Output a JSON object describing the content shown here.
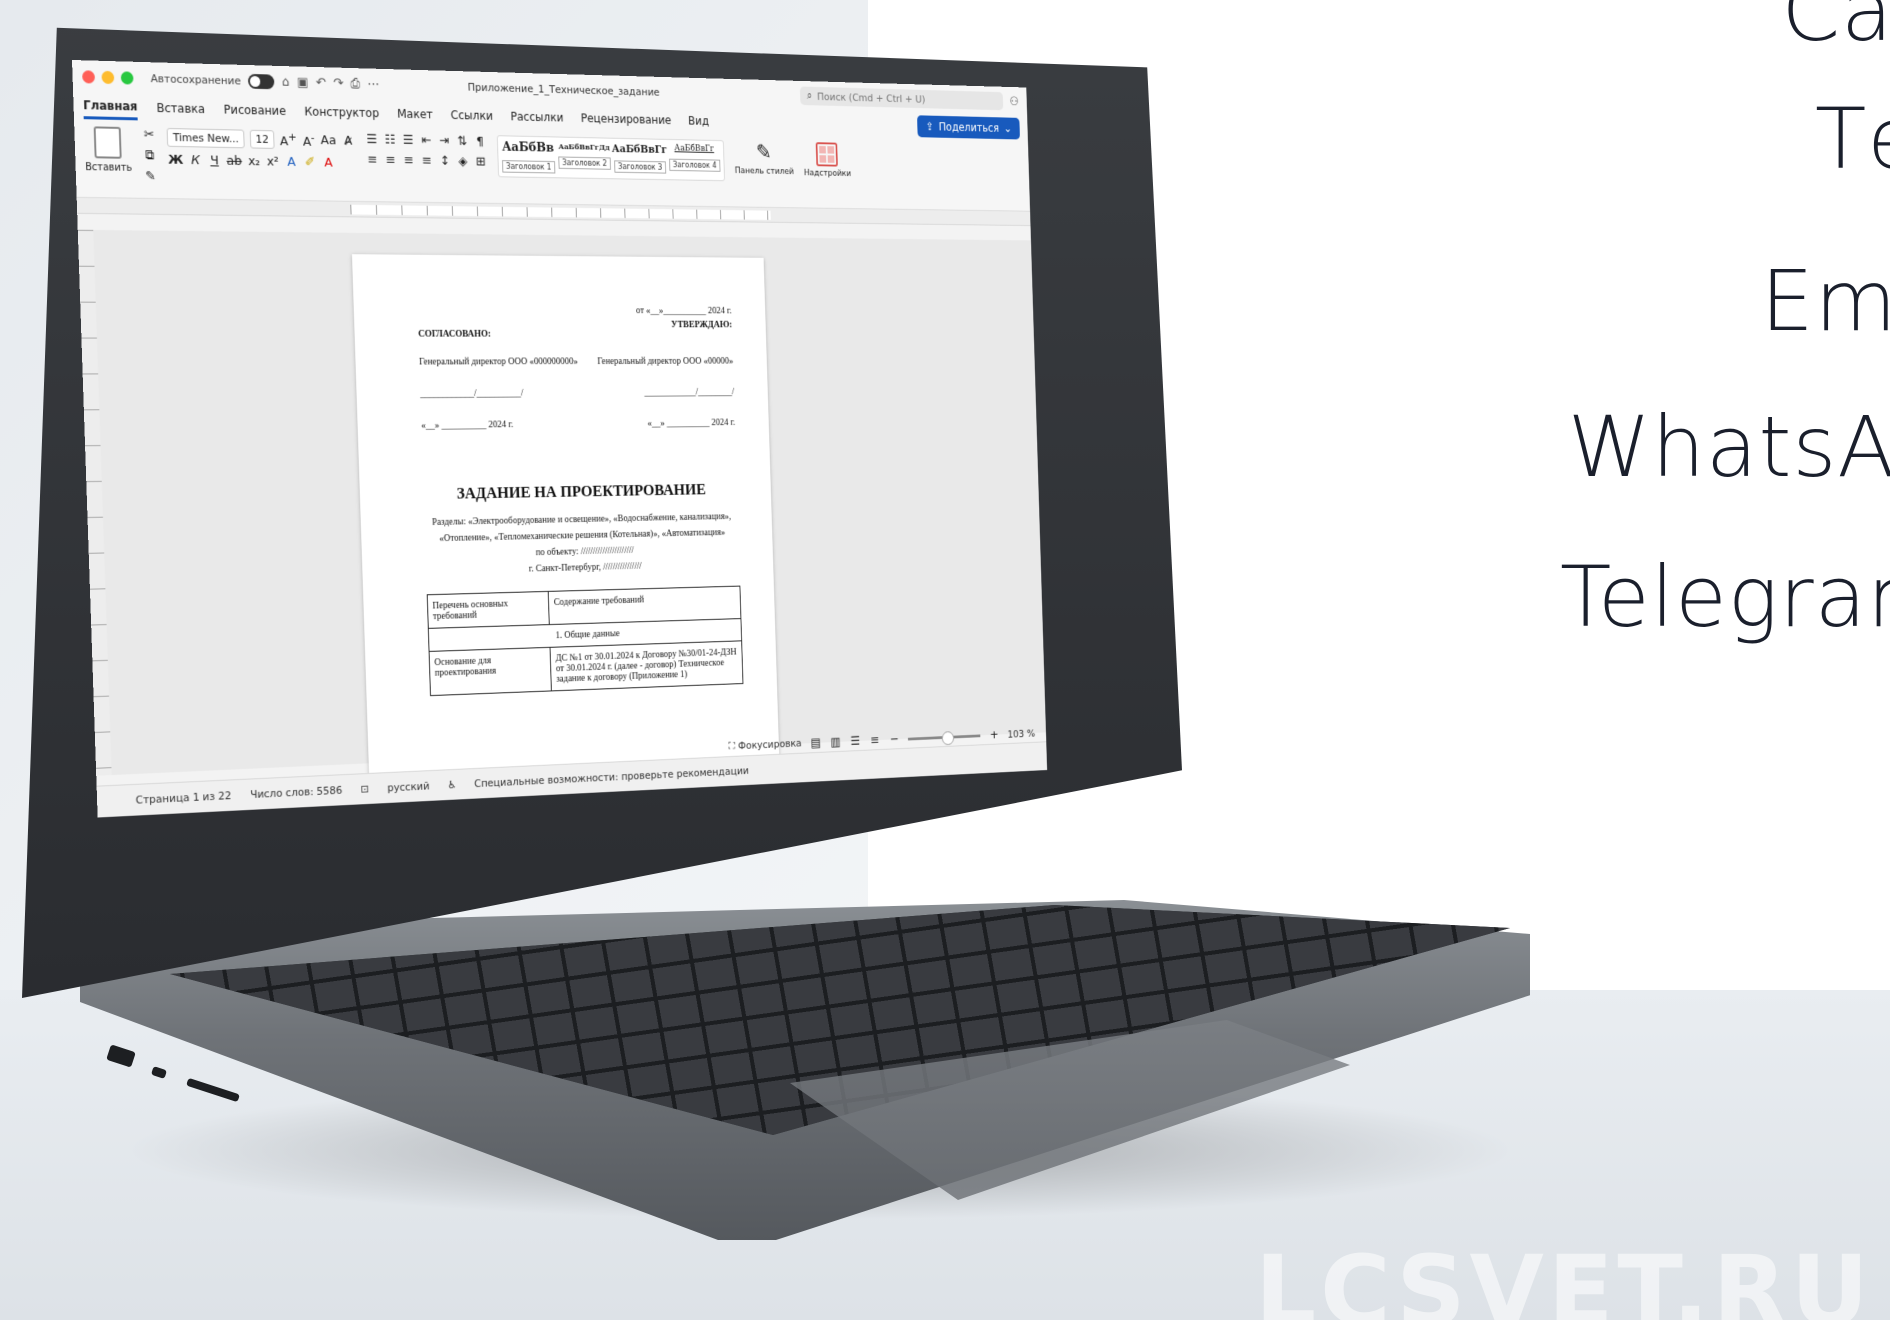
{
  "word": {
    "title_bar": {
      "autosave_label": "Автосохранение",
      "document_title": "Приложение_1_Техническое_задание",
      "search_placeholder": "Поиск (Cmd + Ctrl + U)"
    },
    "tabs": [
      "Главная",
      "Вставка",
      "Рисование",
      "Конструктор",
      "Макет",
      "Ссылки",
      "Рассылки",
      "Рецензирование",
      "Вид"
    ],
    "share_label": "Поделиться",
    "ribbon": {
      "paste_label": "Вставить",
      "font_name": "Times New...",
      "font_size": "12",
      "styles": [
        {
          "sample": "АаБбВв",
          "label": "Заголовок 1"
        },
        {
          "sample": "АаБбВвГгДд",
          "label": "Заголовок 2"
        },
        {
          "sample": "АаБбВвГг",
          "label": "Заголовок 3"
        },
        {
          "sample": "АаБбВвГг",
          "label": "Заголовок 4"
        }
      ],
      "styles_pane_label": "Панель стилей",
      "addins_label": "Надстройки"
    },
    "document": {
      "date_line": "от «__»__________ 2024 г.",
      "approved_left": "СОГЛАСОВАНО:",
      "approved_right": "УТВЕРЖДАЮ:",
      "director_left": "Генеральный директор ООО «000000000»",
      "director_right": "Генеральный директор ООО «00000»",
      "signature_line_left": "____________/__________/",
      "signature_line_right": "____________/________/",
      "date_left": "«__» __________ 2024 г.",
      "date_right": "«__» __________ 2024 г.",
      "heading": "ЗАДАНИЕ НА ПРОЕКТИРОВАНИЕ",
      "sections_line1": "Разделы: «Электрооборудование и освещение», «Водоснабжение, канализация»,",
      "sections_line2": "«Отопление», «Тепломеханические решения (Котельная)», «Автоматизация»",
      "object_line": "по объекту: //////////////////////",
      "city_line": "г. Санкт-Петербург, ////////////////",
      "table": {
        "header_left": "Перечень основных требований",
        "header_right": "Содержание требований",
        "section_row": "1.  Общие данные",
        "row_left": "Основание для проектирования",
        "row_right": "ДС №1 от 30.01.2024 к Договору №30/01-24-ДЗН от 30.01.2024 г. (далее - договор) Техническое задание к договору (Приложение 1)"
      }
    },
    "view": {
      "focus_label": "Фокусировка",
      "zoom": "103 %"
    },
    "status_bar": {
      "page": "Страница 1 из 22",
      "words": "Число слов: 5586",
      "language": "русский",
      "accessibility": "Специальные возможности: проверьте рекомендации"
    }
  },
  "contacts": [
    "Сай",
    "Те",
    "Ema",
    "WhatsAp",
    "Telegram"
  ],
  "watermark": "LCSVET.RU"
}
